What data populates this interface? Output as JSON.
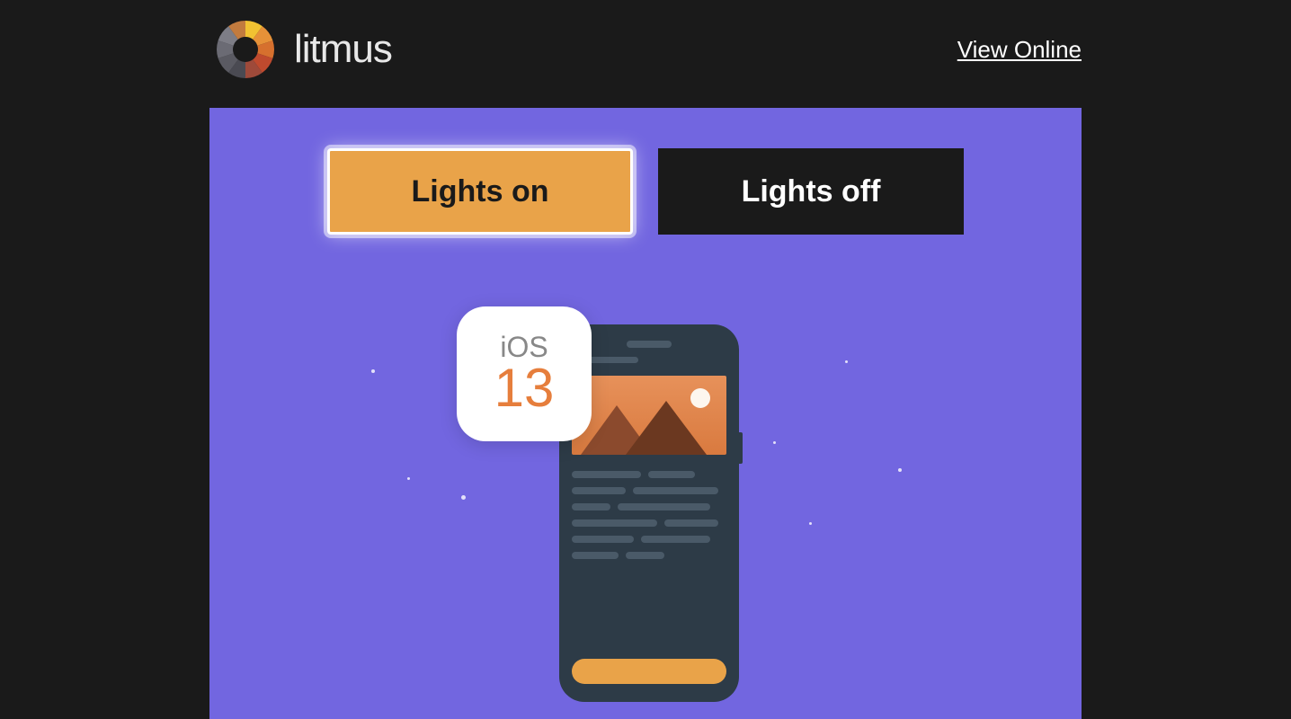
{
  "header": {
    "brand_name": "litmus",
    "view_online_label": "View Online"
  },
  "hero": {
    "buttons": {
      "lights_on": "Lights on",
      "lights_off": "Lights off"
    },
    "ios_badge": {
      "label": "iOS",
      "version": "13"
    }
  },
  "colors": {
    "page_bg": "#1a1a1a",
    "hero_bg": "#7266e0",
    "accent_orange": "#e9a349",
    "phone_body": "#2d3b47"
  },
  "logo_segments": [
    "#e69138",
    "#f1c232",
    "#c27b3e",
    "#bf4a2e",
    "#4a4a52",
    "#5a5a62",
    "#6b6b74",
    "#7d7d86",
    "#9e4a3a",
    "#d6702e"
  ]
}
